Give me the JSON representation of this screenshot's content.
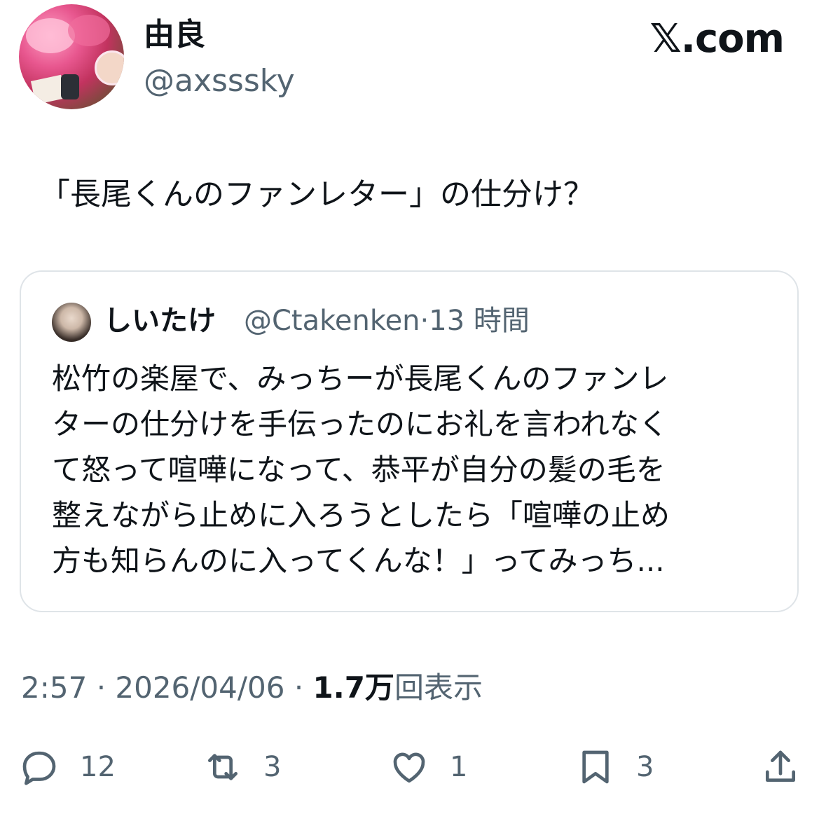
{
  "author": {
    "display_name": "由良",
    "handle": "@axsssky"
  },
  "brand": "𝕏.com",
  "tweet": {
    "text": "「長尾くんのファンレター」の仕分け？"
  },
  "quote": {
    "display_name": "しいたけ",
    "handle_time": "@Ctakenken·13 時間",
    "lines": [
      "松竹の楽屋で、みっちーが長尾くんのファンレ",
      "ターの仕分けを手伝ったのにお礼を言われなく",
      "て怒って喧嘩になって、恭平が自分の髪の毛を",
      "整えながら止めに入ろうとしたら「喧嘩の止め",
      "方も知らんのに入ってくんな！」ってみっち..."
    ]
  },
  "meta": {
    "time": "2:57",
    "date": "2026/04/06",
    "views_count": "1.7万",
    "views_label": "回表示"
  },
  "actions": {
    "replies": "12",
    "reposts": "3",
    "likes": "1",
    "bookmarks": "3"
  },
  "icons": [
    "reply-icon",
    "repost-icon",
    "like-icon",
    "bookmark-icon",
    "share-icon"
  ],
  "colors": {
    "text": "#0f1419",
    "secondary": "#536471",
    "border": "#dfe4e8"
  }
}
